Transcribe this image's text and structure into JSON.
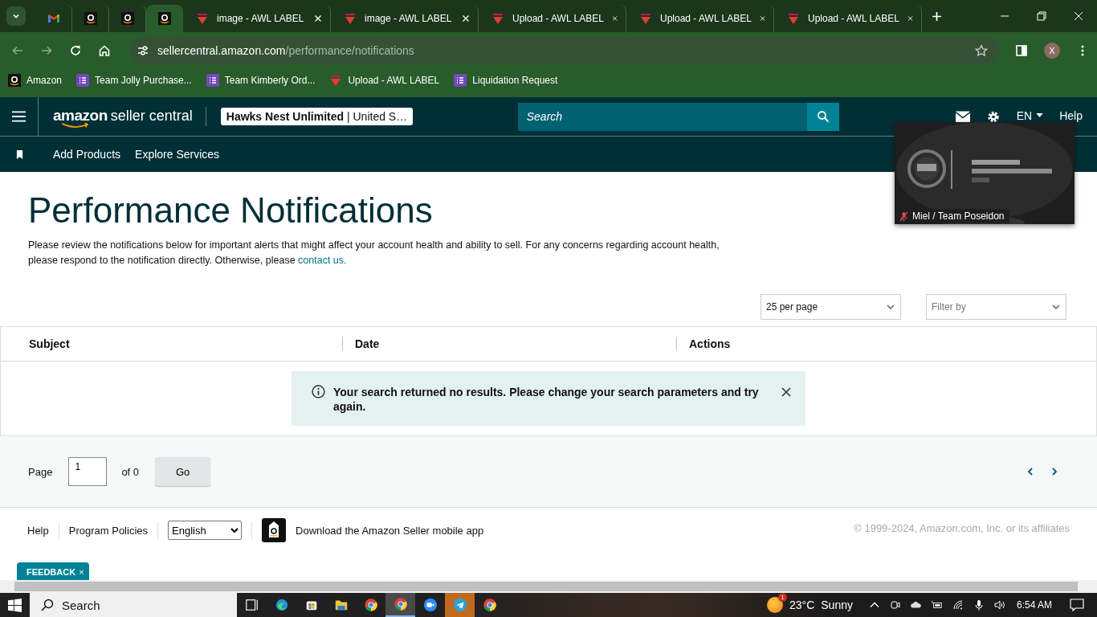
{
  "browser": {
    "tabs": [
      {
        "kind": "gmail",
        "selected": false
      },
      {
        "kind": "amazon",
        "selected": false
      },
      {
        "kind": "amazon",
        "selected": false
      },
      {
        "kind": "amazon",
        "selected": true
      },
      {
        "kind": "awl",
        "title": "image - AWL LABEL",
        "selected": false
      },
      {
        "kind": "awl",
        "title": "image - AWL LABEL",
        "selected": false
      },
      {
        "kind": "awl",
        "title": "Upload - AWL LABEL",
        "selected": false
      },
      {
        "kind": "awl",
        "title": "Upload - AWL LABEL",
        "selected": false
      },
      {
        "kind": "awl",
        "title": "Upload - AWL LABEL",
        "selected": false
      }
    ],
    "url": {
      "host": "sellercentral.amazon.com",
      "path": "/performance/notifications"
    },
    "profile_initial": "X",
    "bookmarks": [
      {
        "label": "Amazon",
        "kind": "amazon"
      },
      {
        "label": "Team Jolly Purchase...",
        "kind": "list"
      },
      {
        "label": "Team Kimberly Ord...",
        "kind": "list"
      },
      {
        "label": "Upload - AWL LABEL",
        "kind": "awl"
      },
      {
        "label": "Liquidation Request",
        "kind": "list"
      }
    ]
  },
  "header": {
    "logo_word": "amazon",
    "logo_subtitle": "seller central",
    "account": {
      "name": "Hawks Nest Unlimited",
      "separator": "|",
      "region": "United S…"
    },
    "search": {
      "placeholder": "Search"
    },
    "language": "EN",
    "help": "Help"
  },
  "nav": {
    "items": [
      "Add Products",
      "Explore Services"
    ]
  },
  "page": {
    "title": "Performance Notifications",
    "intro": "Please review the notifications below for important alerts that might affect your account health and ability to sell. For any concerns regarding account health, please respond to the notification directly. Otherwise, please ",
    "intro_link": "contact us.",
    "per_page": "25 per page",
    "filter": {
      "placeholder": "Filter by"
    },
    "table": {
      "columns": [
        "Subject",
        "Date",
        "Actions"
      ],
      "message": "Your search returned no results. Please change your search parameters and try again."
    },
    "pagination": {
      "label": "Page",
      "value": "1",
      "of": "of 0",
      "go": "Go"
    }
  },
  "footer": {
    "links": [
      "Help",
      "Program Policies"
    ],
    "language": "English",
    "app_text": "Download the Amazon Seller mobile app",
    "copyright": "© 1999-2024, Amazon.com, Inc. or its affiliates"
  },
  "feedback": {
    "label": "FEEDBACK",
    "close": "×"
  },
  "video": {
    "name": "Miel / Team Poseidon",
    "muted": true
  },
  "taskbar": {
    "search": "Search",
    "apps": [
      {
        "kind": "taskview",
        "active": false,
        "attention": false
      },
      {
        "kind": "edge",
        "active": false,
        "attention": false
      },
      {
        "kind": "store",
        "active": false,
        "attention": false
      },
      {
        "kind": "explorer",
        "active": false,
        "attention": false
      },
      {
        "kind": "chrome",
        "active": false,
        "attention": false
      },
      {
        "kind": "chrome",
        "active": true,
        "attention": false
      },
      {
        "kind": "zoom",
        "active": false,
        "attention": false
      },
      {
        "kind": "telegram",
        "active": false,
        "attention": true
      },
      {
        "kind": "chrome",
        "active": false,
        "attention": false
      }
    ],
    "weather": {
      "badge": "1",
      "temp": "23°C",
      "condition": "Sunny"
    },
    "time": "6:54 AM"
  }
}
